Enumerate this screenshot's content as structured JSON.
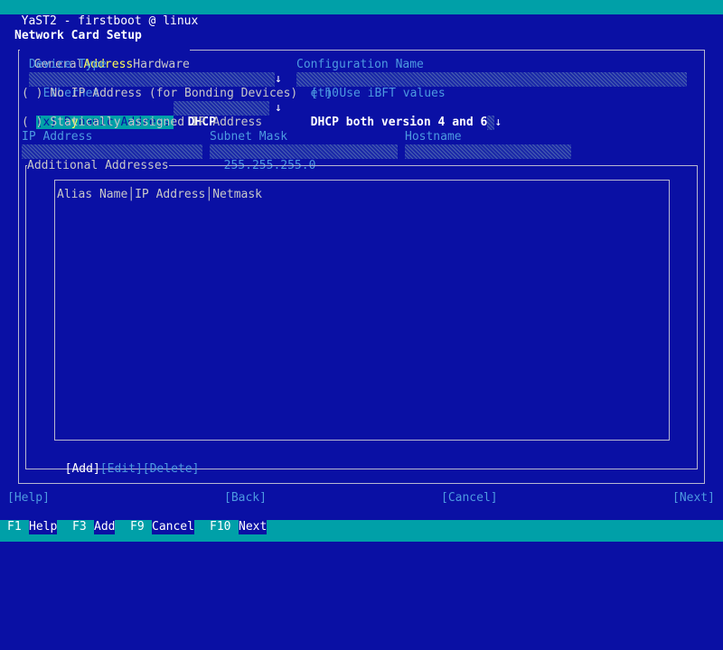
{
  "window_title": "YaST2 - firstboot @ linux",
  "dialog_title": "Network Card Setup",
  "tabs": [
    {
      "label": "General"
    },
    {
      "label": "Address"
    },
    {
      "label": "Hardware"
    }
  ],
  "device_type": {
    "label": "Device Type",
    "value": "Ethernet"
  },
  "config_name": {
    "label": "Configuration Name",
    "value": "eth0"
  },
  "no_ip": {
    "marker": "( )",
    "label": "No IP Address (for Bonding Devices)"
  },
  "ibft": {
    "marker": "[ ]",
    "label": "Use iBFT values"
  },
  "dynamic": {
    "marker": "(x)",
    "label_pre": "D",
    "label_hot": "y",
    "label_post": "namic Address",
    "mode_value": "DHCP",
    "version_value": "DHCP both version 4 and 6"
  },
  "static": {
    "marker": "( )",
    "label": "Statically assigned IP Address"
  },
  "ip_address": {
    "label": "IP Address",
    "value": ""
  },
  "subnet_mask": {
    "label": "Subnet Mask",
    "value": "255.255.255.0"
  },
  "hostname": {
    "label": "Hostname",
    "value": ""
  },
  "additional": {
    "title": "Additional Addresses",
    "columns": [
      "Alias Name",
      "IP Address",
      "Netmask"
    ],
    "rows": []
  },
  "table_buttons": {
    "add": "Add",
    "edit": "Edit",
    "delete": "Delete"
  },
  "nav_buttons": {
    "help": "Help",
    "back": "Back",
    "cancel": "Cancel",
    "next": "Next"
  },
  "function_keys": [
    {
      "key": "F1",
      "label": "Help"
    },
    {
      "key": "F3",
      "label": "Add"
    },
    {
      "key": "F9",
      "label": "Cancel"
    },
    {
      "key": "F10",
      "label": "Next"
    }
  ],
  "arrow_glyph": "↓"
}
